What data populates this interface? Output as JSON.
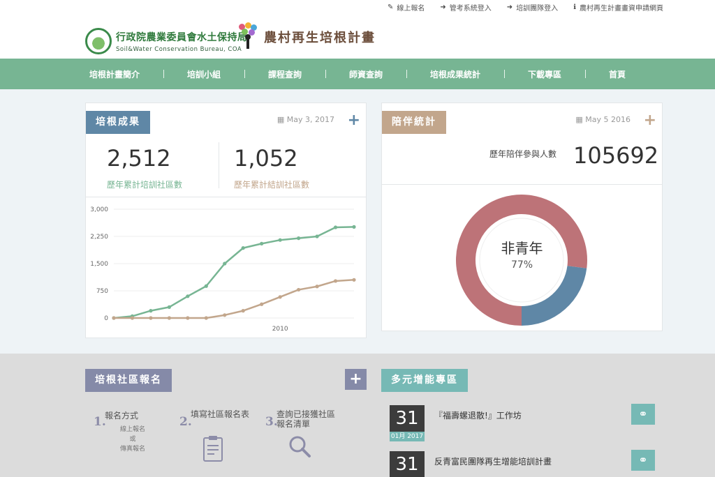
{
  "util_links": [
    {
      "icon": "pencil-icon",
      "glyph": "✎",
      "label": "線上報名"
    },
    {
      "icon": "login-icon",
      "glyph": "➜",
      "label": "管考系統登入"
    },
    {
      "icon": "login-icon",
      "glyph": "➜",
      "label": "培訓團隊登入"
    },
    {
      "icon": "info-icon",
      "glyph": "ℹ",
      "label": "農村再生計畫畫資申請網頁"
    }
  ],
  "logo": {
    "agency": "行政院農業委員會水土保持局",
    "agency_en": "Soil&Water Conservation Bureau, COA",
    "program": "農村再生培根計畫"
  },
  "nav": [
    "培根計畫簡介",
    "培訓小組",
    "課程查詢",
    "師資查詢",
    "培根成果統計",
    "下載專區",
    "首頁"
  ],
  "results": {
    "tag": "培根成果",
    "date": "May 3, 2017",
    "stat1_value": "2,512",
    "stat1_label": "歷年累計培訓社區數",
    "stat2_value": "1,052",
    "stat2_label": "歷年累計結訓社區數"
  },
  "companion": {
    "tag": "陪伴統計",
    "date": "May 5 2016",
    "label": "歷年陪伴參與人數",
    "value": "105692",
    "center_label": "非青年",
    "center_pct": "77%"
  },
  "signup": {
    "tag": "培根社區報名",
    "steps": [
      {
        "num": "1.",
        "title": "報名方式",
        "sub1": "線上報名",
        "sub2": "或",
        "sub3": "傳真報名"
      },
      {
        "num": "2.",
        "title": "填寫社區報名表"
      },
      {
        "num": "3.",
        "title": "查詢已接獲社區報名清單"
      }
    ]
  },
  "multi": {
    "tag": "多元增能專區",
    "events": [
      {
        "day": "31",
        "month": "01月 2017",
        "title": "『福壽螺退散!』工作坊"
      },
      {
        "day": "31",
        "month": "",
        "title": "反青富民團隊再生增能培訓計畫"
      }
    ]
  },
  "colors": {
    "green": "#77b593",
    "brown": "#c2a68c",
    "slate": "#5f87a6",
    "rose": "#bd7378",
    "purple": "#858aa8",
    "teal": "#76b9b5"
  },
  "chart_data": [
    {
      "type": "line",
      "x": [
        2001,
        2002,
        2003,
        2004,
        2005,
        2006,
        2007,
        2008,
        2009,
        2010,
        2011,
        2012,
        2013,
        2014
      ],
      "series": [
        {
          "values": [
            0,
            50,
            200,
            300,
            600,
            880,
            1500,
            1930,
            2050,
            2150,
            2200,
            2250,
            2500,
            2512
          ]
        },
        {
          "values": [
            0,
            0,
            0,
            0,
            0,
            0,
            80,
            200,
            380,
            580,
            780,
            870,
            1020,
            1052
          ]
        }
      ],
      "yticks": [
        "0",
        "750",
        "1,500",
        "2,250",
        "3,000"
      ],
      "xtick_label": "2010",
      "xtick_value": 2010,
      "ylim": [
        0,
        3000
      ],
      "grid": true
    },
    {
      "type": "pie",
      "donut": true,
      "slices": [
        {
          "label": "非青年",
          "value": 77
        },
        {
          "label": "",
          "value": 23
        }
      ]
    }
  ]
}
